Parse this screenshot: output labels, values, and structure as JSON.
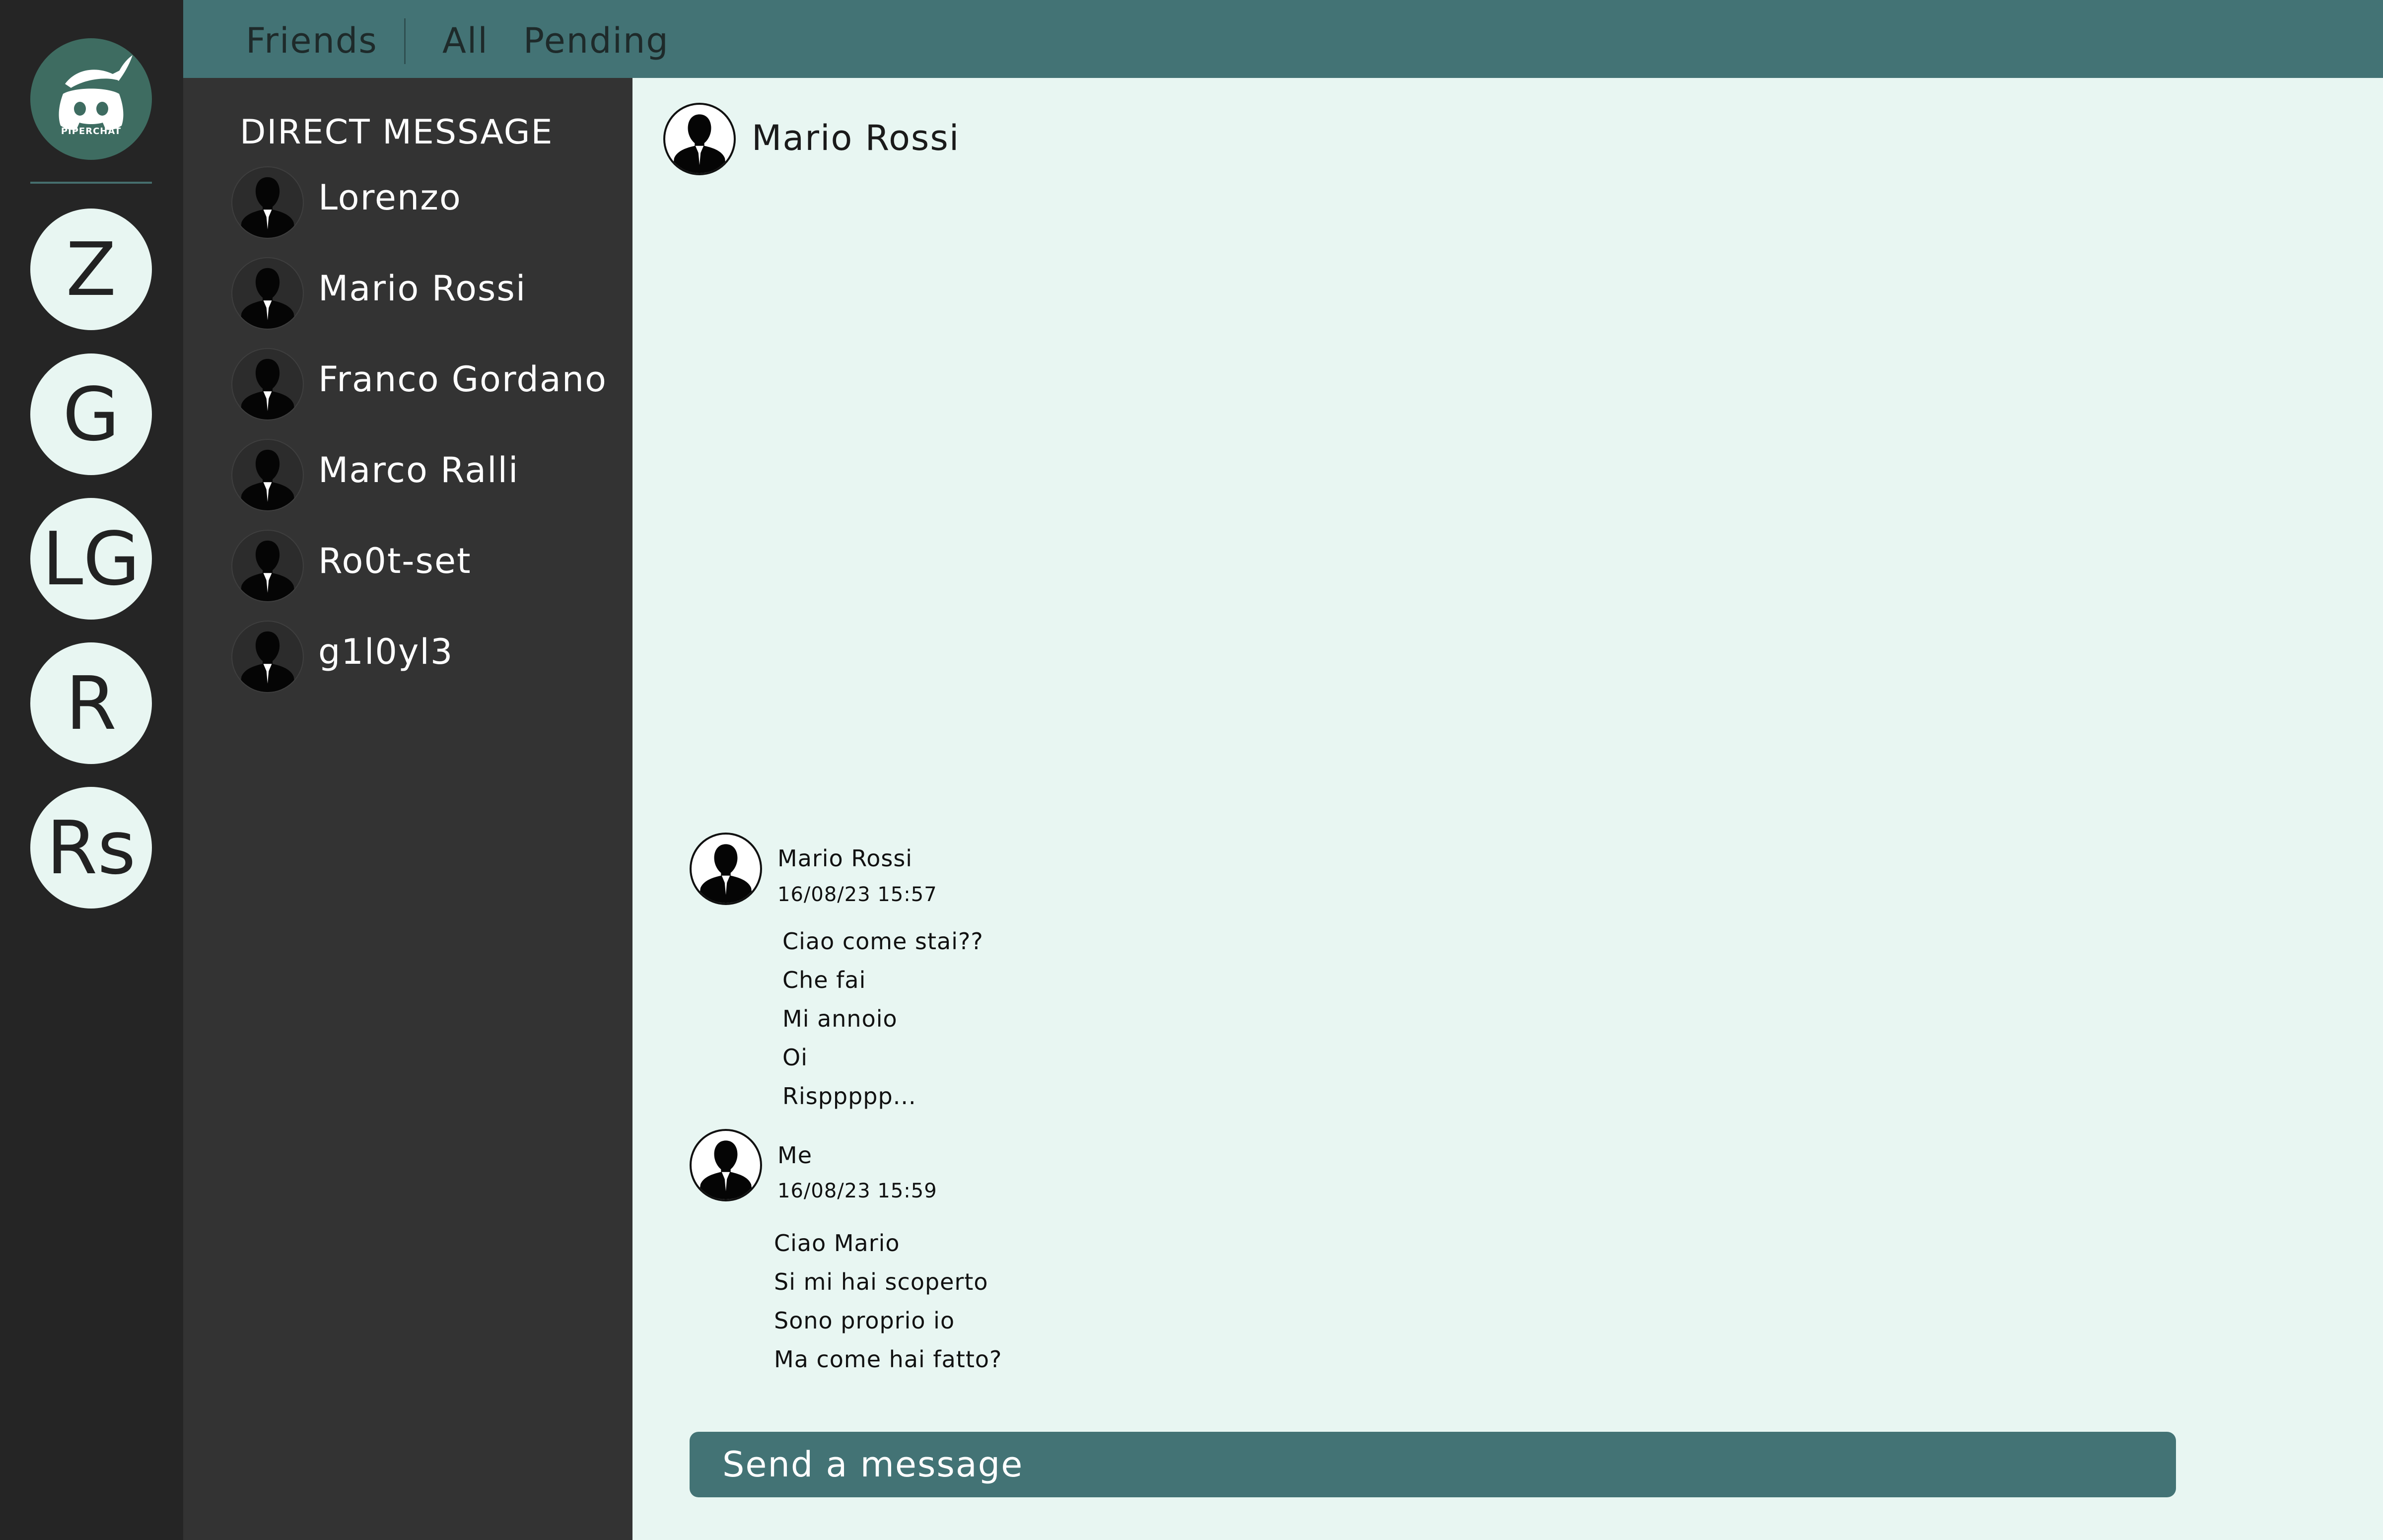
{
  "colors": {
    "rail_bg": "#252525",
    "panel_bg": "#333333",
    "chat_bg": "#e8f6f2",
    "accent": "#437375",
    "logo_bg": "#3e6c61"
  },
  "logo": {
    "text": "PIPERCHAT",
    "icon": "discord-pirate-logo-icon"
  },
  "servers": [
    {
      "label": "Z"
    },
    {
      "label": "G"
    },
    {
      "label": "LG"
    },
    {
      "label": "R"
    },
    {
      "label": "Rs"
    }
  ],
  "topbar": {
    "friends_label": "Friends",
    "all_label": "All",
    "pending_label": "Pending"
  },
  "dm": {
    "title": "DIRECT MESSAGE",
    "items": [
      {
        "name": "Lorenzo",
        "icon": "user-silhouette-icon"
      },
      {
        "name": "Mario Rossi",
        "icon": "user-silhouette-icon"
      },
      {
        "name": "Franco Gordano",
        "icon": "user-silhouette-icon"
      },
      {
        "name": "Marco Ralli",
        "icon": "user-silhouette-icon"
      },
      {
        "name": "Ro0t-set",
        "icon": "user-silhouette-icon"
      },
      {
        "name": "g1l0yl3",
        "icon": "user-silhouette-icon"
      }
    ]
  },
  "chat": {
    "header_name": "Mario Rossi",
    "messages": [
      {
        "author": "Mario Rossi",
        "time": "16/08/23 15:57",
        "lines": [
          "Ciao come stai??",
          "Che fai",
          "Mi annoio",
          "Oi",
          "Risppppp..."
        ]
      },
      {
        "author": "Me",
        "time": "16/08/23 15:59",
        "lines": [
          "Ciao Mario",
          "Si mi hai scoperto",
          "Sono proprio io",
          "Ma come hai fatto?"
        ]
      }
    ],
    "composer_placeholder": "Send a message"
  }
}
